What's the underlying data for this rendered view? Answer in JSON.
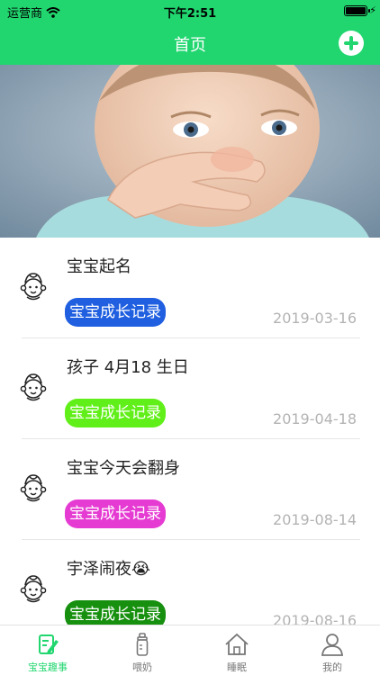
{
  "status_bar": {
    "carrier": "运营商",
    "time": "下午2:51",
    "battery_level": 0.9
  },
  "header": {
    "title": "首页"
  },
  "records": [
    {
      "title": "宝宝起名",
      "tag": "宝宝成长记录",
      "tag_color": "#1f5fe0",
      "date": "2019-03-16"
    },
    {
      "title": "孩子 4月18 生日",
      "tag": "宝宝成长记录",
      "tag_color": "#61ef19",
      "date": "2019-04-18"
    },
    {
      "title": "宝宝今天会翻身",
      "tag": "宝宝成长记录",
      "tag_color": "#e53bd2",
      "date": "2019-08-14"
    },
    {
      "title": "宇泽闹夜😭",
      "tag": "宝宝成长记录",
      "tag_color": "#17900f",
      "date": "2019-08-16"
    }
  ],
  "tabs": [
    {
      "label": "宝宝趣事",
      "icon": "edit-icon",
      "active": true
    },
    {
      "label": "喂奶",
      "icon": "bottle-icon",
      "active": false
    },
    {
      "label": "睡眠",
      "icon": "home-icon",
      "active": false
    },
    {
      "label": "我的",
      "icon": "person-icon",
      "active": false
    }
  ],
  "accent_color": "#21d66f"
}
